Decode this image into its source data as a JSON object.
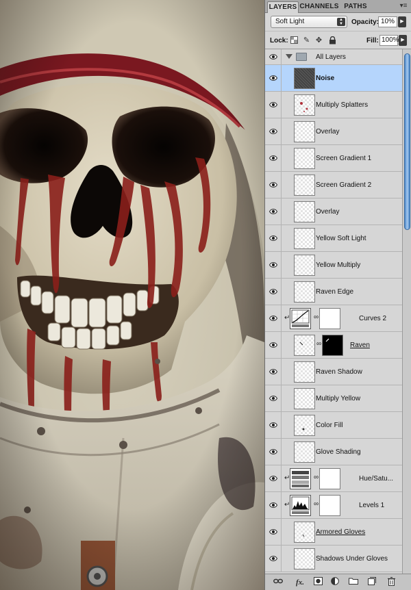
{
  "panel": {
    "tabs": [
      {
        "label": "LAYERS",
        "active": true
      },
      {
        "label": "CHANNELS",
        "active": false
      },
      {
        "label": "PATHS",
        "active": false
      }
    ],
    "menu_icon": "panel-menu-icon",
    "blend_mode": "Soft Light",
    "opacity_label": "Opacity:",
    "opacity_value": "10%",
    "lock_label": "Lock:",
    "lock_icons": [
      "lock-transparency-icon",
      "lock-image-icon",
      "lock-position-icon",
      "lock-all-icon"
    ],
    "fill_label": "Fill:",
    "fill_value": "100%"
  },
  "layers": [
    {
      "name": "All Layers",
      "kind": "group"
    },
    {
      "name": "Noise",
      "kind": "layer",
      "selected": true,
      "thumb": "noise"
    },
    {
      "name": "Multiply Splatters",
      "kind": "layer"
    },
    {
      "name": "Overlay",
      "kind": "layer"
    },
    {
      "name": "Screen Gradient 1",
      "kind": "layer"
    },
    {
      "name": "Screen Gradient 2",
      "kind": "layer"
    },
    {
      "name": "Overlay",
      "kind": "layer"
    },
    {
      "name": "Yellow Soft Light",
      "kind": "layer"
    },
    {
      "name": "Yellow Multiply",
      "kind": "layer"
    },
    {
      "name": "Raven Edge",
      "kind": "layer"
    },
    {
      "name": "Curves 2",
      "kind": "adjustment",
      "adj": "curves"
    },
    {
      "name": "Raven",
      "kind": "masked",
      "underline": true
    },
    {
      "name": "Raven Shadow",
      "kind": "layer"
    },
    {
      "name": "Multiply Yellow",
      "kind": "layer"
    },
    {
      "name": "Color Fill",
      "kind": "layer"
    },
    {
      "name": "Glove Shading",
      "kind": "layer"
    },
    {
      "name": "Hue/Satu...",
      "kind": "adjustment",
      "adj": "hue"
    },
    {
      "name": "Levels 1",
      "kind": "adjustment",
      "adj": "levels"
    },
    {
      "name": "Armored Gloves",
      "kind": "layer",
      "underline": true
    },
    {
      "name": "Shadows Under Gloves",
      "kind": "layer"
    }
  ],
  "bottom_buttons": [
    "link-layers-icon",
    "fx-icon",
    "add-mask-icon",
    "adjustment-layer-icon",
    "new-group-icon",
    "new-layer-icon",
    "trash-icon"
  ],
  "bottom_labels": {
    "fx": "fx."
  },
  "colors": {
    "selection": "#b5d5fc",
    "panel_bg": "#d6d6d6",
    "scroll_accent": "#4a86c8"
  }
}
